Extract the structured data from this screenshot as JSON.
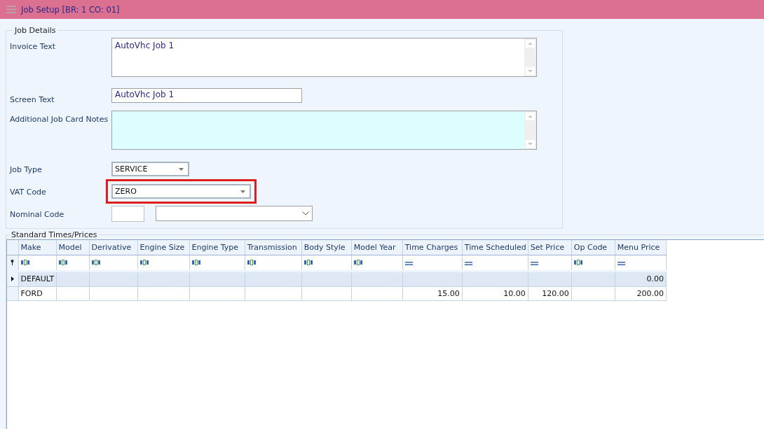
{
  "window": {
    "title": "Job Setup [BR: 1 CO: 01]"
  },
  "job_details": {
    "title": "Job Details",
    "fields": [
      {
        "kind": "textarea",
        "label": "Invoice Text",
        "value": "AutoVhc Job 1",
        "tinted": false
      },
      {
        "kind": "text",
        "label": "Screen Text",
        "value": "AutoVhc Job 1"
      },
      {
        "kind": "textarea",
        "label": "Additional Job Card Notes",
        "tinted": true
      },
      {
        "kind": "dropdown",
        "label": "Job Type",
        "value": "SERVICE",
        "highlighted": false
      },
      {
        "kind": "dropdown",
        "label": "VAT Code",
        "value": "ZERO",
        "highlighted": true
      },
      {
        "kind": "code_dropdown",
        "label": "Nominal Code"
      }
    ]
  },
  "standard_times": {
    "title": "Standard Times/Prices",
    "columns": [
      {
        "label": "Make",
        "kind": "text"
      },
      {
        "label": "Model",
        "kind": "text"
      },
      {
        "label": "Derivative",
        "kind": "text"
      },
      {
        "label": "Engine Size",
        "kind": "text"
      },
      {
        "label": "Engine Type",
        "kind": "text"
      },
      {
        "label": "Transmission",
        "kind": "text"
      },
      {
        "label": "Body Style",
        "kind": "text"
      },
      {
        "label": "Model Year",
        "kind": "text"
      },
      {
        "label": "Time Charges",
        "kind": "number"
      },
      {
        "label": "Time Scheduled",
        "kind": "number"
      },
      {
        "label": "Set Price",
        "kind": "number"
      },
      {
        "label": "Op Code",
        "kind": "text"
      },
      {
        "label": "Menu Price",
        "kind": "number"
      }
    ],
    "rows": [
      {
        "selected": true,
        "cells": [
          "DEFAULT",
          "",
          "",
          "",
          "",
          "",
          "",
          "",
          "",
          "",
          "",
          "",
          "0.00"
        ]
      },
      {
        "selected": false,
        "cells": [
          "FORD",
          "",
          "",
          "",
          "",
          "",
          "",
          "",
          "15.00",
          "10.00",
          "120.00",
          "",
          "200.00"
        ]
      }
    ]
  }
}
